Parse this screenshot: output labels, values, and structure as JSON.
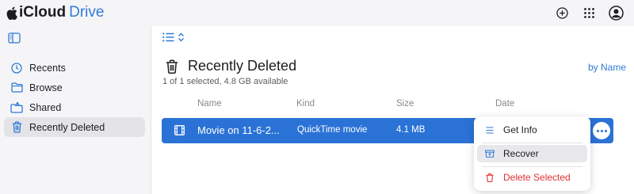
{
  "app": {
    "brand_icloud": "iCloud",
    "brand_drive": "Drive",
    "accent": "#2f7ad6"
  },
  "topbar": {
    "icons": [
      "add-circle-icon",
      "app-grid-icon",
      "account-icon"
    ]
  },
  "sidebar": {
    "toggle_icon": "sidebar-toggle-icon",
    "items": [
      {
        "label": "Recents",
        "icon": "clock-icon",
        "active": false
      },
      {
        "label": "Browse",
        "icon": "folder-icon",
        "active": false
      },
      {
        "label": "Shared",
        "icon": "shared-folder-icon",
        "active": false
      },
      {
        "label": "Recently Deleted",
        "icon": "trash-icon",
        "active": true
      }
    ]
  },
  "main": {
    "title": "Recently Deleted",
    "subtitle": "1 of 1 selected, 4.8 GB available",
    "sort_label": "by Name",
    "columns": [
      "Name",
      "Kind",
      "Size",
      "Date"
    ],
    "rows": [
      {
        "name": "Movie on 11-6-2...",
        "kind": "QuickTime movie",
        "size": "4.1 MB",
        "date": "",
        "selected": true,
        "icon": "film-icon"
      }
    ]
  },
  "context_menu": {
    "items": [
      {
        "label": "Get Info",
        "icon": "info-list-icon"
      },
      {
        "label": "Recover",
        "icon": "recover-tray-icon"
      },
      {
        "label": "Delete Selected",
        "icon": "trash-icon",
        "color": "#e0302f"
      }
    ]
  }
}
